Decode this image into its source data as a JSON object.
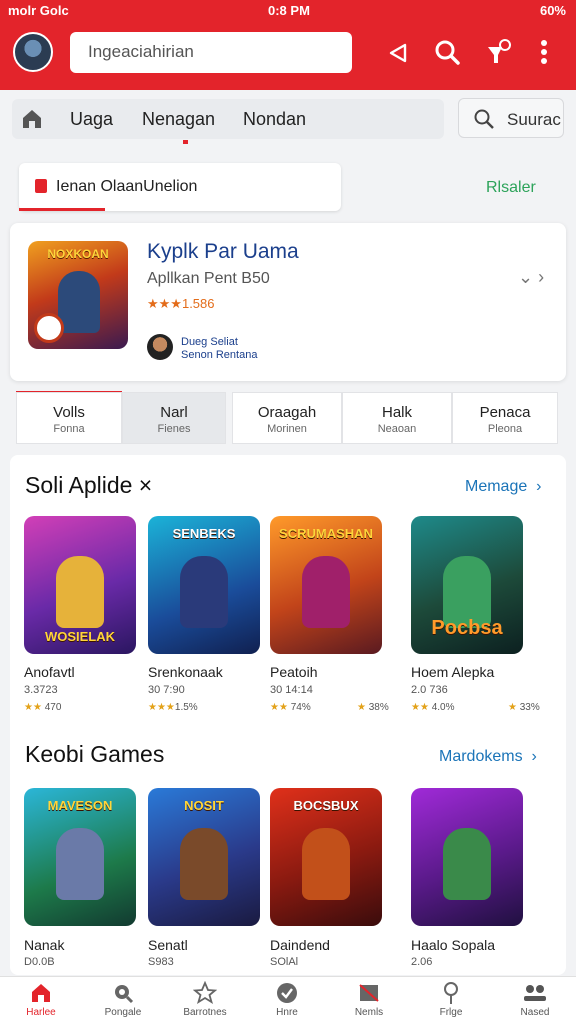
{
  "status": {
    "left": "molr Golc",
    "time": "0:8 PM",
    "battery": "60%"
  },
  "header": {
    "search_placeholder": "Ingeaciahirian"
  },
  "tabs": [
    {
      "label": "Uaga"
    },
    {
      "label": "Nenagan"
    },
    {
      "label": "Nondan"
    }
  ],
  "search_button": {
    "label": "Suurac"
  },
  "notice": {
    "text": "Ienan OlaanUnelion",
    "link": "Rlsaler"
  },
  "featured": {
    "art_title": "NOXKOAN",
    "title": "Kyplk Par Uama",
    "subtitle": "Apllkan Pent B50",
    "rating": "★★★1.586",
    "developer_line1": "Dueg Seliat",
    "developer_line2": "Senon Rentana"
  },
  "chips": [
    {
      "title": "Volls",
      "sub": "Fonna"
    },
    {
      "title": "Narl",
      "sub": "Fienes"
    },
    {
      "title": "Oraagah",
      "sub": "Morinen"
    },
    {
      "title": "Halk",
      "sub": "Neaoan"
    },
    {
      "title": "Penaca",
      "sub": "Pleona"
    }
  ],
  "section1": {
    "title": "Soli Aplide ×",
    "more": "Memage",
    "games": [
      {
        "art": "WOSIELAK",
        "name": "Anofavtl",
        "meta": "3.3723",
        "rating": "470"
      },
      {
        "art": "SENBEKS",
        "name": "Srenkonaak",
        "meta": "30 7:90",
        "rating": "1.5%"
      },
      {
        "art": "SCRUMASHAN",
        "name": "Peatoih",
        "meta": "30 14:14",
        "rating": "74%",
        "rating2": "38%"
      },
      {
        "art": "Pocbsa",
        "name": "Hoem Alepka",
        "meta": "2.0 736",
        "rating": "4.0%",
        "rating2": "33%"
      }
    ]
  },
  "section2": {
    "title": "Keobi Games",
    "more": "Mardokems",
    "games": [
      {
        "art": "MAVESON",
        "name": "Nanak",
        "meta": "D0.0B"
      },
      {
        "art": "NOSIT",
        "name": "Senatl",
        "meta": "S983"
      },
      {
        "art": "BOCSBUX",
        "name": "Daindend",
        "meta": "SOlAl"
      },
      {
        "art": "",
        "name": "Haalo Sopala",
        "meta": "2.06"
      }
    ]
  },
  "bottom_nav": [
    {
      "label": "Harlee",
      "icon": "home-icon"
    },
    {
      "label": "Pongale",
      "icon": "search-icon"
    },
    {
      "label": "Barrotnes",
      "icon": "star-icon"
    },
    {
      "label": "Hnre",
      "icon": "check-icon"
    },
    {
      "label": "Nemls",
      "icon": "mail-icon"
    },
    {
      "label": "Frlge",
      "icon": "pin-icon"
    },
    {
      "label": "Nased",
      "icon": "people-icon"
    }
  ],
  "colors": {
    "brand": "#e3242b",
    "link": "#1b74b8",
    "accent_green": "#2da35a"
  }
}
